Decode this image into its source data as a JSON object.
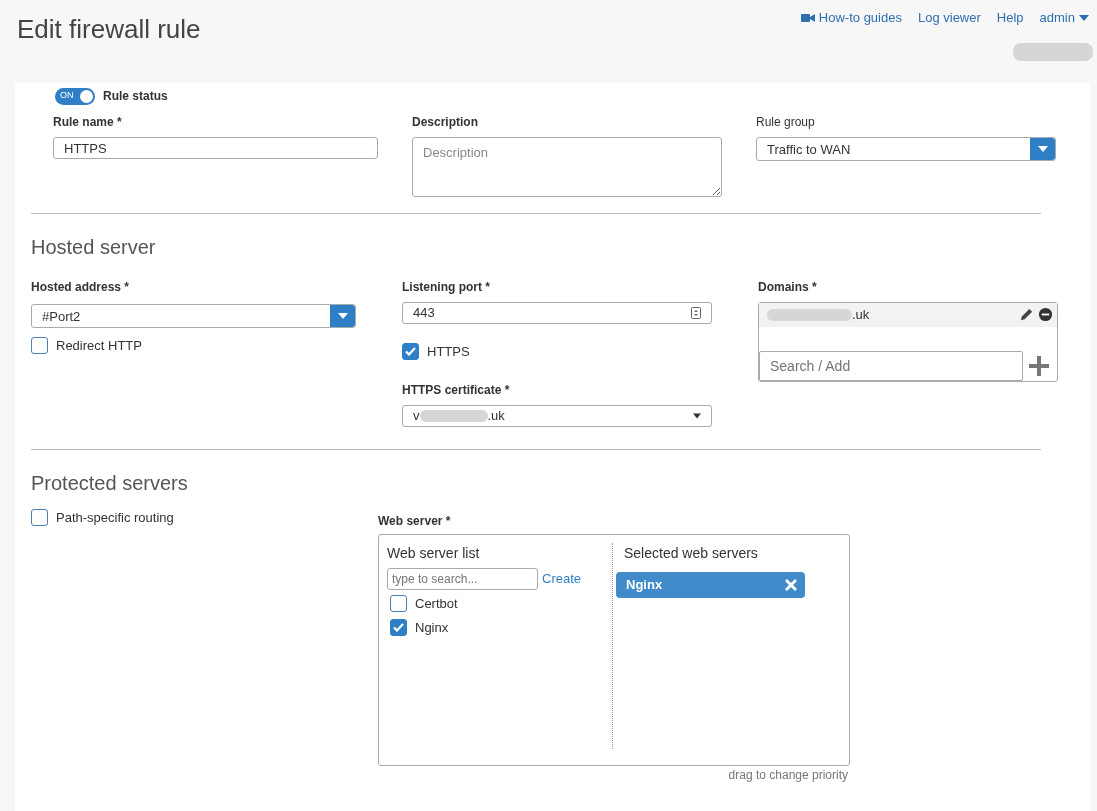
{
  "title": "Edit firewall rule",
  "top_links": [
    {
      "label": "How-to guides",
      "kind": "video"
    },
    {
      "label": "Log viewer",
      "kind": "link"
    },
    {
      "label": "Help",
      "kind": "link"
    },
    {
      "label": "admin",
      "kind": "menu"
    }
  ],
  "rule_status": {
    "label": "Rule status",
    "on": true,
    "toggle_text": "ON"
  },
  "rule_name": {
    "label": "Rule name *",
    "value": "HTTPS"
  },
  "description": {
    "label": "Description",
    "placeholder": "Description"
  },
  "rule_group": {
    "label": "Rule group",
    "value": "Traffic to WAN"
  },
  "hosted_server": {
    "heading": "Hosted server",
    "hosted_address": {
      "label": "Hosted address *",
      "value": "#Port2"
    },
    "redirect_http": {
      "label": "Redirect HTTP",
      "checked": false
    },
    "listening_port": {
      "label": "Listening port *",
      "value": "443"
    },
    "https": {
      "label": "HTTPS",
      "checked": true
    },
    "https_certificate": {
      "label": "HTTPS certificate *",
      "value_parts": [
        "v",
        ".uk"
      ]
    },
    "domains": {
      "label": "Domains *",
      "items": [
        ".uk"
      ],
      "search_placeholder": "Search / Add"
    }
  },
  "protected_servers": {
    "heading": "Protected servers",
    "path_specific_routing": {
      "label": "Path-specific routing",
      "checked": false
    },
    "web_server": {
      "label": "Web server *",
      "list_title": "Web server list",
      "search_placeholder": "type to search...",
      "create_link": "Create",
      "items": [
        {
          "label": "Certbot",
          "checked": false
        },
        {
          "label": "Nginx",
          "checked": true
        }
      ],
      "selected_title": "Selected web servers",
      "selected": [
        "Nginx"
      ],
      "hint": "drag to change priority"
    }
  }
}
